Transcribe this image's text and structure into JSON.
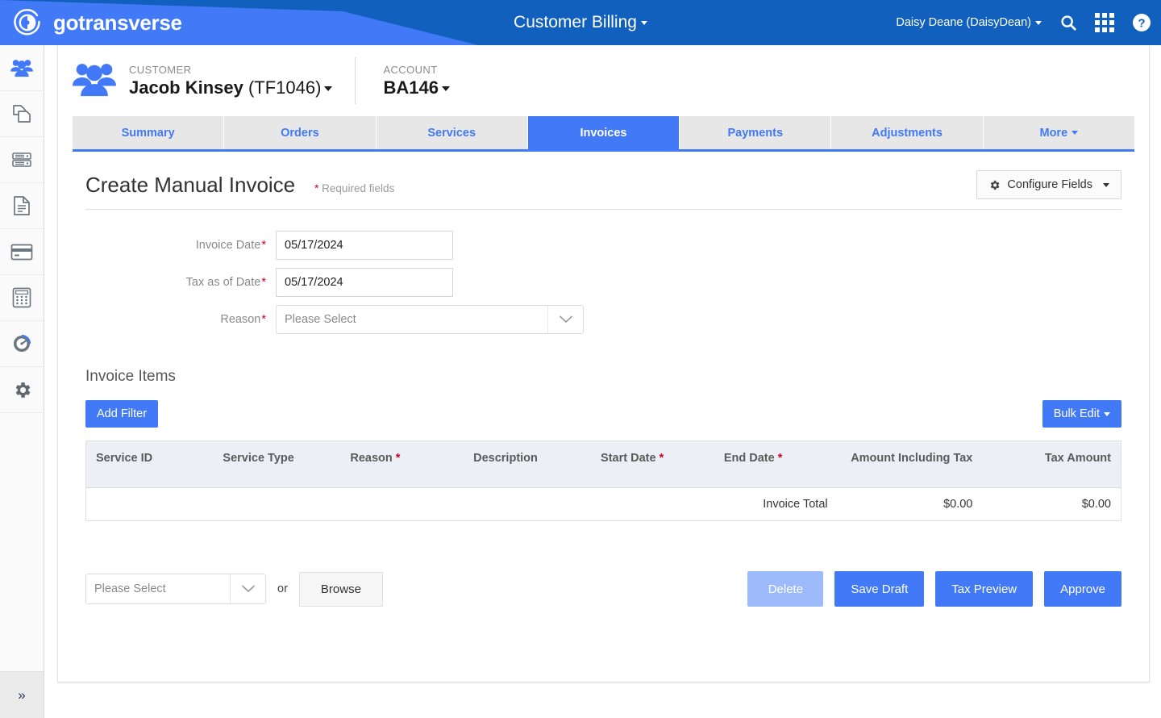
{
  "topbar": {
    "brand": "gotransverse",
    "app_title": "Customer Billing",
    "user": "Daisy Deane (DaisyDean)",
    "icons": [
      "search-icon",
      "apps-grid-icon",
      "help-icon"
    ],
    "colors": {
      "dark_blue": "#1160bd",
      "light_blue": "#4179f7"
    }
  },
  "sidebar": {
    "items": [
      {
        "icon": "customers-icon",
        "active": true
      },
      {
        "icon": "documents-copy-icon",
        "active": false
      },
      {
        "icon": "database-icon",
        "active": false
      },
      {
        "icon": "file-document-icon",
        "active": false
      },
      {
        "icon": "credit-card-icon",
        "active": false
      },
      {
        "icon": "calculator-icon",
        "active": false
      },
      {
        "icon": "dashboard-gauge-icon",
        "active": false
      },
      {
        "icon": "gear-settings-icon",
        "active": false
      }
    ],
    "expand_glyph": "»"
  },
  "entity": {
    "customer_label": "CUSTOMER",
    "customer_name": "Jacob Kinsey",
    "customer_id": "(TF1046)",
    "account_label": "ACCOUNT",
    "account_value": "BA146"
  },
  "tabs": [
    {
      "label": "Summary",
      "active": false
    },
    {
      "label": "Orders",
      "active": false
    },
    {
      "label": "Services",
      "active": false
    },
    {
      "label": "Invoices",
      "active": true
    },
    {
      "label": "Payments",
      "active": false
    },
    {
      "label": "Adjustments",
      "active": false
    },
    {
      "label": "More",
      "active": false,
      "has_caret": true
    }
  ],
  "page": {
    "title": "Create Manual Invoice",
    "required_star": "*",
    "required_note": "Required fields",
    "configure_fields": "Configure Fields"
  },
  "form": {
    "invoice_date": {
      "label": "Invoice Date",
      "required": "*",
      "value": "05/17/2024"
    },
    "tax_as_of_date": {
      "label": "Tax as of Date",
      "required": "*",
      "value": "05/17/2024"
    },
    "reason": {
      "label": "Reason",
      "required": "*",
      "value": "Please Select"
    }
  },
  "items": {
    "section_title": "Invoice Items",
    "add_filter": "Add Filter",
    "bulk_edit": "Bulk Edit",
    "columns": [
      {
        "label": "Service ID",
        "required": false,
        "align": "left"
      },
      {
        "label": "Service Type",
        "required": false,
        "align": "left"
      },
      {
        "label": "Reason",
        "required": true,
        "align": "left"
      },
      {
        "label": "Description",
        "required": false,
        "align": "left"
      },
      {
        "label": "Start Date",
        "required": true,
        "align": "left"
      },
      {
        "label": "End Date",
        "required": true,
        "align": "left"
      },
      {
        "label": "Amount Including Tax",
        "required": false,
        "align": "right"
      },
      {
        "label": "Tax Amount",
        "required": false,
        "align": "right"
      }
    ],
    "total_row": {
      "label": "Invoice Total",
      "amount_including_tax": "$0.00",
      "tax_amount": "$0.00"
    }
  },
  "footer": {
    "file_select": "Please Select",
    "or": "or",
    "browse": "Browse",
    "actions": [
      {
        "label": "Delete",
        "disabled": true
      },
      {
        "label": "Save Draft",
        "disabled": false
      },
      {
        "label": "Tax Preview",
        "disabled": false
      },
      {
        "label": "Approve",
        "disabled": false
      }
    ]
  }
}
